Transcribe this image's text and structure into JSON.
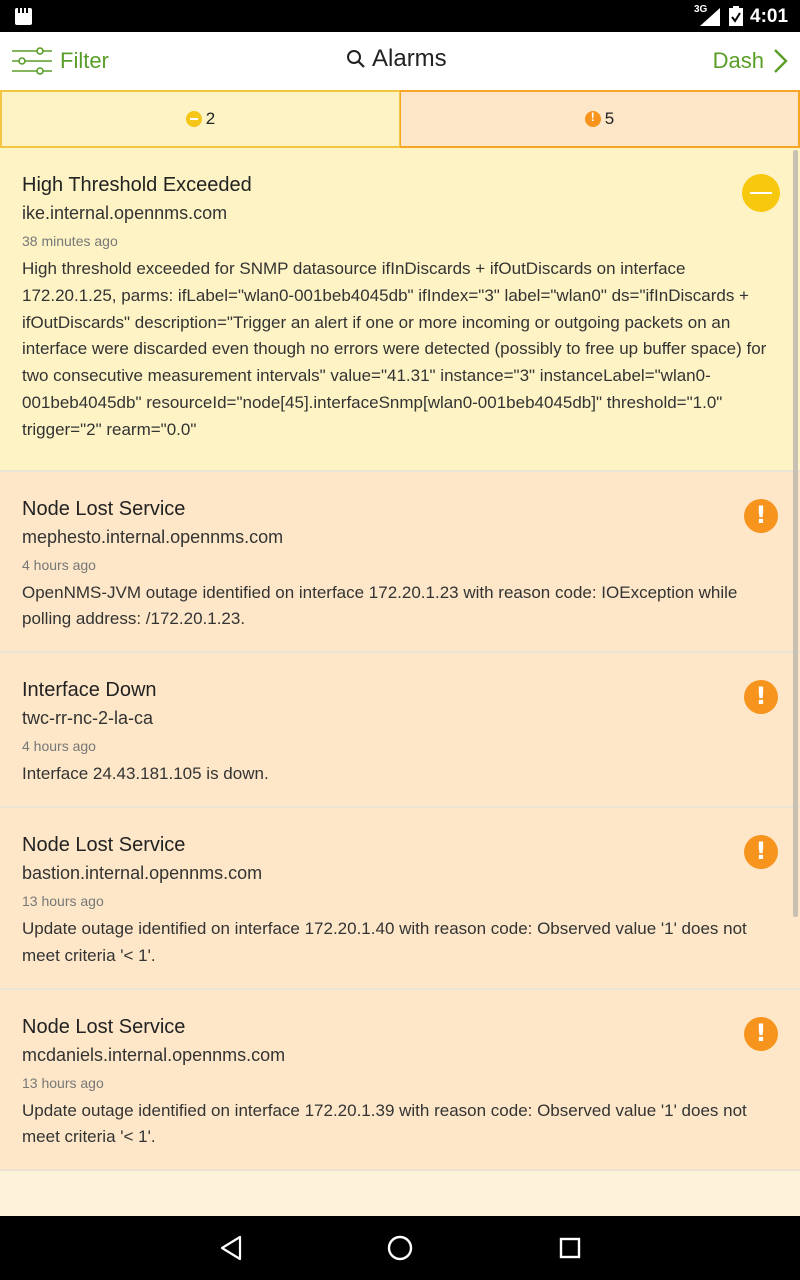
{
  "status_bar": {
    "network": "3G",
    "time": "4:01",
    "icons": [
      "sd-card-icon",
      "signal-icon",
      "battery-icon"
    ]
  },
  "header": {
    "filter_label": "Filter",
    "title": "Alarms",
    "dash_label": "Dash"
  },
  "tabs": [
    {
      "severity": "minor",
      "count": "2"
    },
    {
      "severity": "major",
      "count": "5"
    }
  ],
  "colors": {
    "accent": "#5a9e2a",
    "minor": "#f8c80f",
    "major": "#f7941d",
    "minor_bg": "#fdf3c5",
    "major_bg": "#fde7c8"
  },
  "alarms": [
    {
      "severity": "minor",
      "title": "High Threshold Exceeded",
      "host": "ike.internal.opennms.com",
      "time": "38 minutes ago",
      "description": "High threshold exceeded for SNMP datasource ifInDiscards + ifOutDiscards on interface 172.20.1.25, parms: ifLabel=\"wlan0-001beb4045db\" ifIndex=\"3\" label=\"wlan0\" ds=\"ifInDiscards + ifOutDiscards\" description=\"Trigger an alert if one or more incoming or outgoing packets on an interface were discarded even though no errors were detected (possibly to free up buffer space) for two consecutive measurement intervals\" value=\"41.31\" instance=\"3\" instanceLabel=\"wlan0-001beb4045db\" resourceId=\"node[45].interfaceSnmp[wlan0-001beb4045db]\" threshold=\"1.0\" trigger=\"2\" rearm=\"0.0\""
    },
    {
      "severity": "major",
      "title": "Node Lost Service",
      "host": "mephesto.internal.opennms.com",
      "time": "4 hours ago",
      "description": "OpenNMS-JVM outage identified on interface 172.20.1.23 with reason code: IOException while polling address: /172.20.1.23."
    },
    {
      "severity": "major",
      "title": "Interface Down",
      "host": "twc-rr-nc-2-la-ca",
      "time": "4 hours ago",
      "description": "Interface 24.43.181.105 is down."
    },
    {
      "severity": "major",
      "title": "Node Lost Service",
      "host": "bastion.internal.opennms.com",
      "time": "13 hours ago",
      "description": "Update outage identified on interface 172.20.1.40 with reason code: Observed value '1' does not meet criteria '< 1'."
    },
    {
      "severity": "major",
      "title": "Node Lost Service",
      "host": "mcdaniels.internal.opennms.com",
      "time": "13 hours ago",
      "description": "Update outage identified on interface 172.20.1.39 with reason code: Observed value '1' does not meet criteria '< 1'."
    }
  ]
}
